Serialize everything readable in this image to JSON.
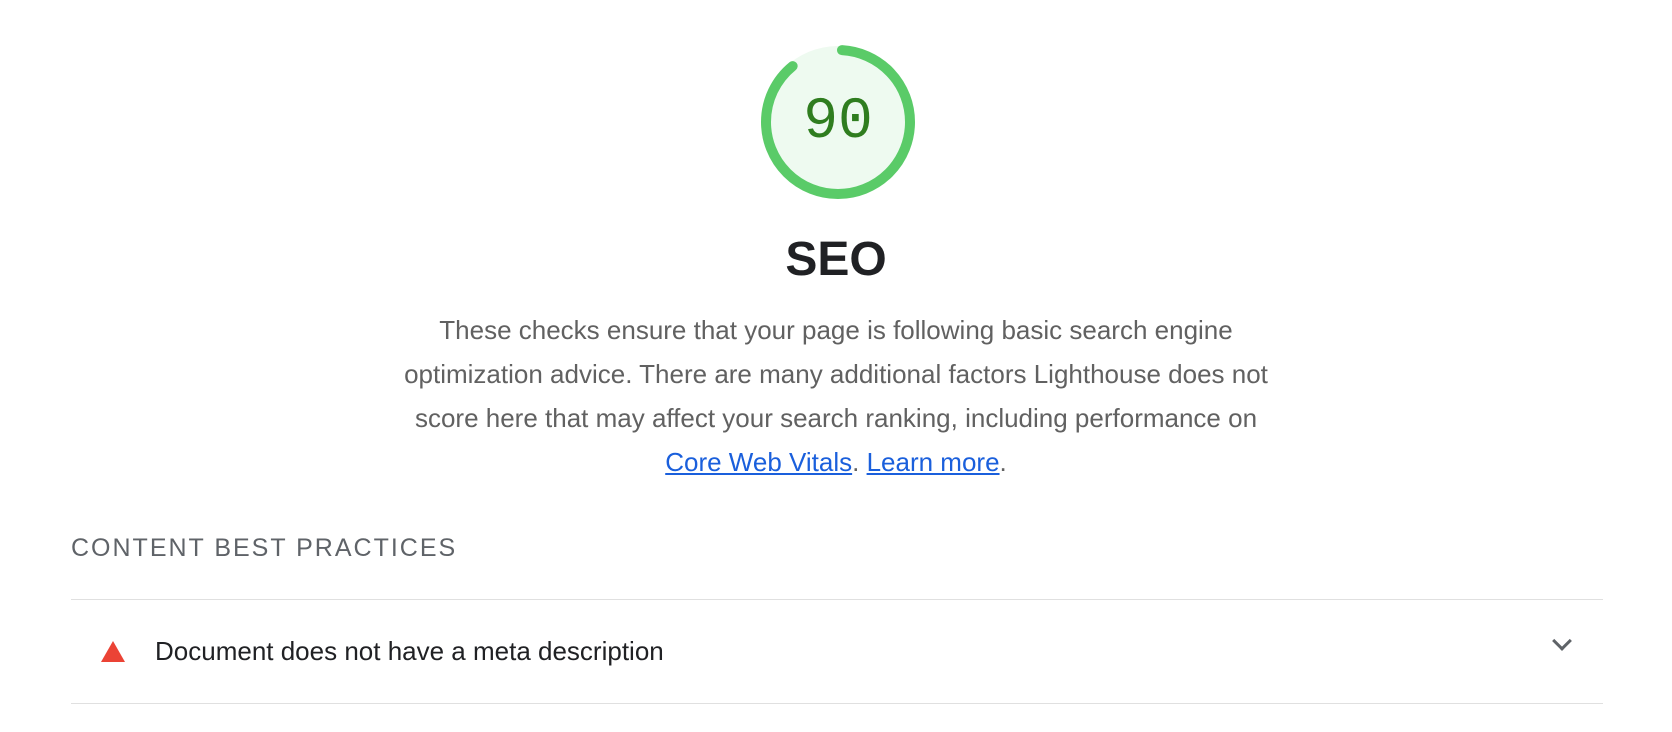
{
  "score": {
    "value": "90",
    "fraction": 0.9,
    "ring_color": "#5acb68",
    "fill_color": "#eefaf0",
    "text_color": "#2f7d1f"
  },
  "category": {
    "title": "SEO",
    "description_before": "These checks ensure that your page is following basic search engine optimization advice. There are many additional factors Lighthouse does not score here that may affect your search ranking, including performance on ",
    "link_core_web_vitals": "Core Web Vitals",
    "description_between": ". ",
    "link_learn_more": "Learn more",
    "description_after": "."
  },
  "group": {
    "title": "CONTENT BEST PRACTICES"
  },
  "audits": [
    {
      "title": "Document does not have a meta description",
      "status": "fail",
      "icon": "triangle-warning-icon",
      "status_color": "#eb4335"
    }
  ],
  "icons": {
    "expand": "chevron-down-icon"
  }
}
